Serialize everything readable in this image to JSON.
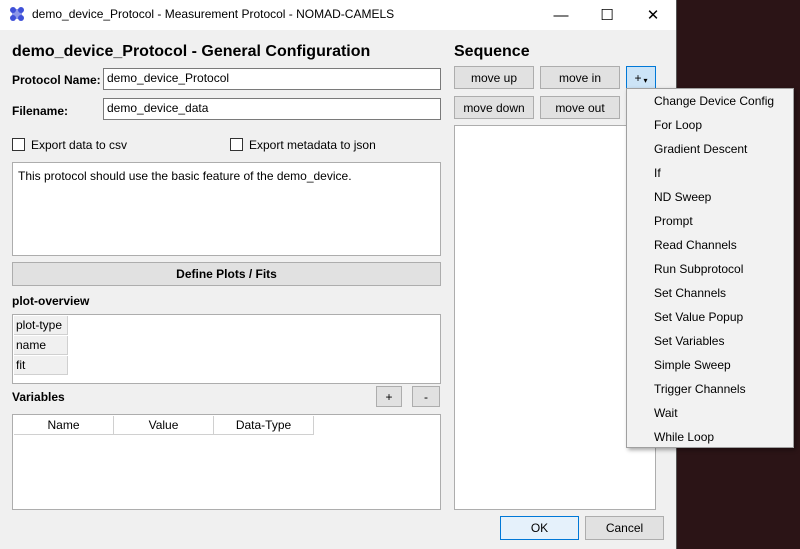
{
  "window": {
    "title": "demo_device_Protocol - Measurement Protocol - NOMAD-CAMELS",
    "minimize_glyph": "—",
    "maximize_glyph": "☐",
    "close_glyph": "✕"
  },
  "config": {
    "heading": "demo_device_Protocol - General Configuration",
    "protocol_name_label": "Protocol Name:",
    "protocol_name_value": "demo_device_Protocol",
    "filename_label": "Filename:",
    "filename_value": "demo_device_data",
    "export_csv_label": "Export data to csv",
    "export_json_label": "Export metadata to json",
    "description": "This protocol should use the basic feature of the demo_device.",
    "define_plots_label": "Define Plots / Fits",
    "plot_overview_label": "plot-overview",
    "plot_rows": [
      "plot-type",
      "name",
      "fit"
    ],
    "variables_label": "Variables",
    "add_variable_label": "+",
    "remove_variable_label": "-",
    "variable_columns": [
      "Name",
      "Value",
      "Data-Type"
    ]
  },
  "sequence": {
    "heading": "Sequence",
    "move_up_label": "move up",
    "move_in_label": "move in",
    "add_label": "+",
    "move_down_label": "move down",
    "move_out_label": "move out"
  },
  "menu_items": [
    "Change Device Config",
    "For Loop",
    "Gradient Descent",
    "If",
    "ND Sweep",
    "Prompt",
    "Read Channels",
    "Run Subprotocol",
    "Set Channels",
    "Set Value Popup",
    "Set Variables",
    "Simple Sweep",
    "Trigger Channels",
    "Wait",
    "While Loop"
  ],
  "footer": {
    "ok_label": "OK",
    "cancel_label": "Cancel"
  },
  "colors": {
    "app_icon": "#3f51d8",
    "desktop": "#2b1416",
    "ok_border": "#0078d7"
  }
}
